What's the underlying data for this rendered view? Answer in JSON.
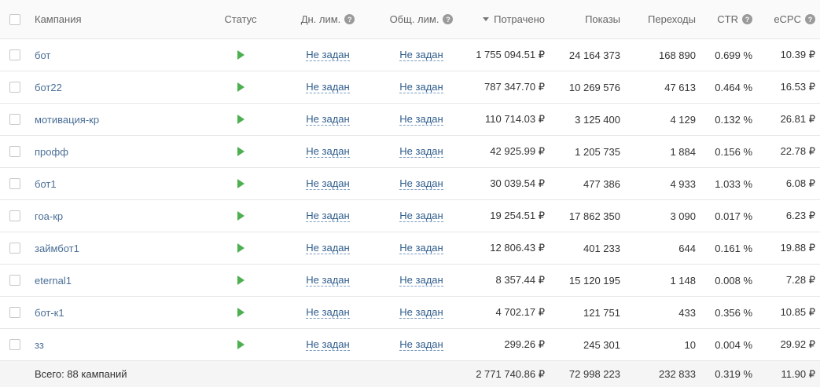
{
  "header": {
    "campaign": "Кампания",
    "status": "Статус",
    "daily_limit": "Дн. лим.",
    "total_limit": "Общ. лим.",
    "spent": "Потрачено",
    "shows": "Показы",
    "clicks": "Переходы",
    "ctr": "CTR",
    "ecpc": "eCPC",
    "help_glyph": "?"
  },
  "rows": [
    {
      "name": "бот",
      "daily": "Не задан",
      "total": "Не задан",
      "spent": "1 755 094.51 ₽",
      "shows": "24 164 373",
      "clicks": "168 890",
      "ctr": "0.699 %",
      "ecpc": "10.39 ₽"
    },
    {
      "name": "бот22",
      "daily": "Не задан",
      "total": "Не задан",
      "spent": "787 347.70 ₽",
      "shows": "10 269 576",
      "clicks": "47 613",
      "ctr": "0.464 %",
      "ecpc": "16.53 ₽"
    },
    {
      "name": "мотивация-кр",
      "daily": "Не задан",
      "total": "Не задан",
      "spent": "110 714.03 ₽",
      "shows": "3 125 400",
      "clicks": "4 129",
      "ctr": "0.132 %",
      "ecpc": "26.81 ₽"
    },
    {
      "name": "профф",
      "daily": "Не задан",
      "total": "Не задан",
      "spent": "42 925.99 ₽",
      "shows": "1 205 735",
      "clicks": "1 884",
      "ctr": "0.156 %",
      "ecpc": "22.78 ₽"
    },
    {
      "name": "бот1",
      "daily": "Не задан",
      "total": "Не задан",
      "spent": "30 039.54 ₽",
      "shows": "477 386",
      "clicks": "4 933",
      "ctr": "1.033 %",
      "ecpc": "6.08 ₽"
    },
    {
      "name": "гоа-кр",
      "daily": "Не задан",
      "total": "Не задан",
      "spent": "19 254.51 ₽",
      "shows": "17 862 350",
      "clicks": "3 090",
      "ctr": "0.017 %",
      "ecpc": "6.23 ₽"
    },
    {
      "name": "займбот1",
      "daily": "Не задан",
      "total": "Не задан",
      "spent": "12 806.43 ₽",
      "shows": "401 233",
      "clicks": "644",
      "ctr": "0.161 %",
      "ecpc": "19.88 ₽"
    },
    {
      "name": "eternal1",
      "daily": "Не задан",
      "total": "Не задан",
      "spent": "8 357.44 ₽",
      "shows": "15 120 195",
      "clicks": "1 148",
      "ctr": "0.008 %",
      "ecpc": "7.28 ₽"
    },
    {
      "name": "бот-к1",
      "daily": "Не задан",
      "total": "Не задан",
      "spent": "4 702.17 ₽",
      "shows": "121 751",
      "clicks": "433",
      "ctr": "0.356 %",
      "ecpc": "10.85 ₽"
    },
    {
      "name": "зз",
      "daily": "Не задан",
      "total": "Не задан",
      "spent": "299.26 ₽",
      "shows": "245 301",
      "clicks": "10",
      "ctr": "0.004 %",
      "ecpc": "29.92 ₽"
    }
  ],
  "footer": {
    "label": "Всего: 88 кампаний",
    "spent": "2 771 740.86 ₽",
    "shows": "72 998 223",
    "clicks": "232 833",
    "ctr": "0.319 %",
    "ecpc": "11.90 ₽"
  },
  "colors": {
    "link": "#4a6f96",
    "play": "#4caf50",
    "border": "#e6e6e6"
  }
}
